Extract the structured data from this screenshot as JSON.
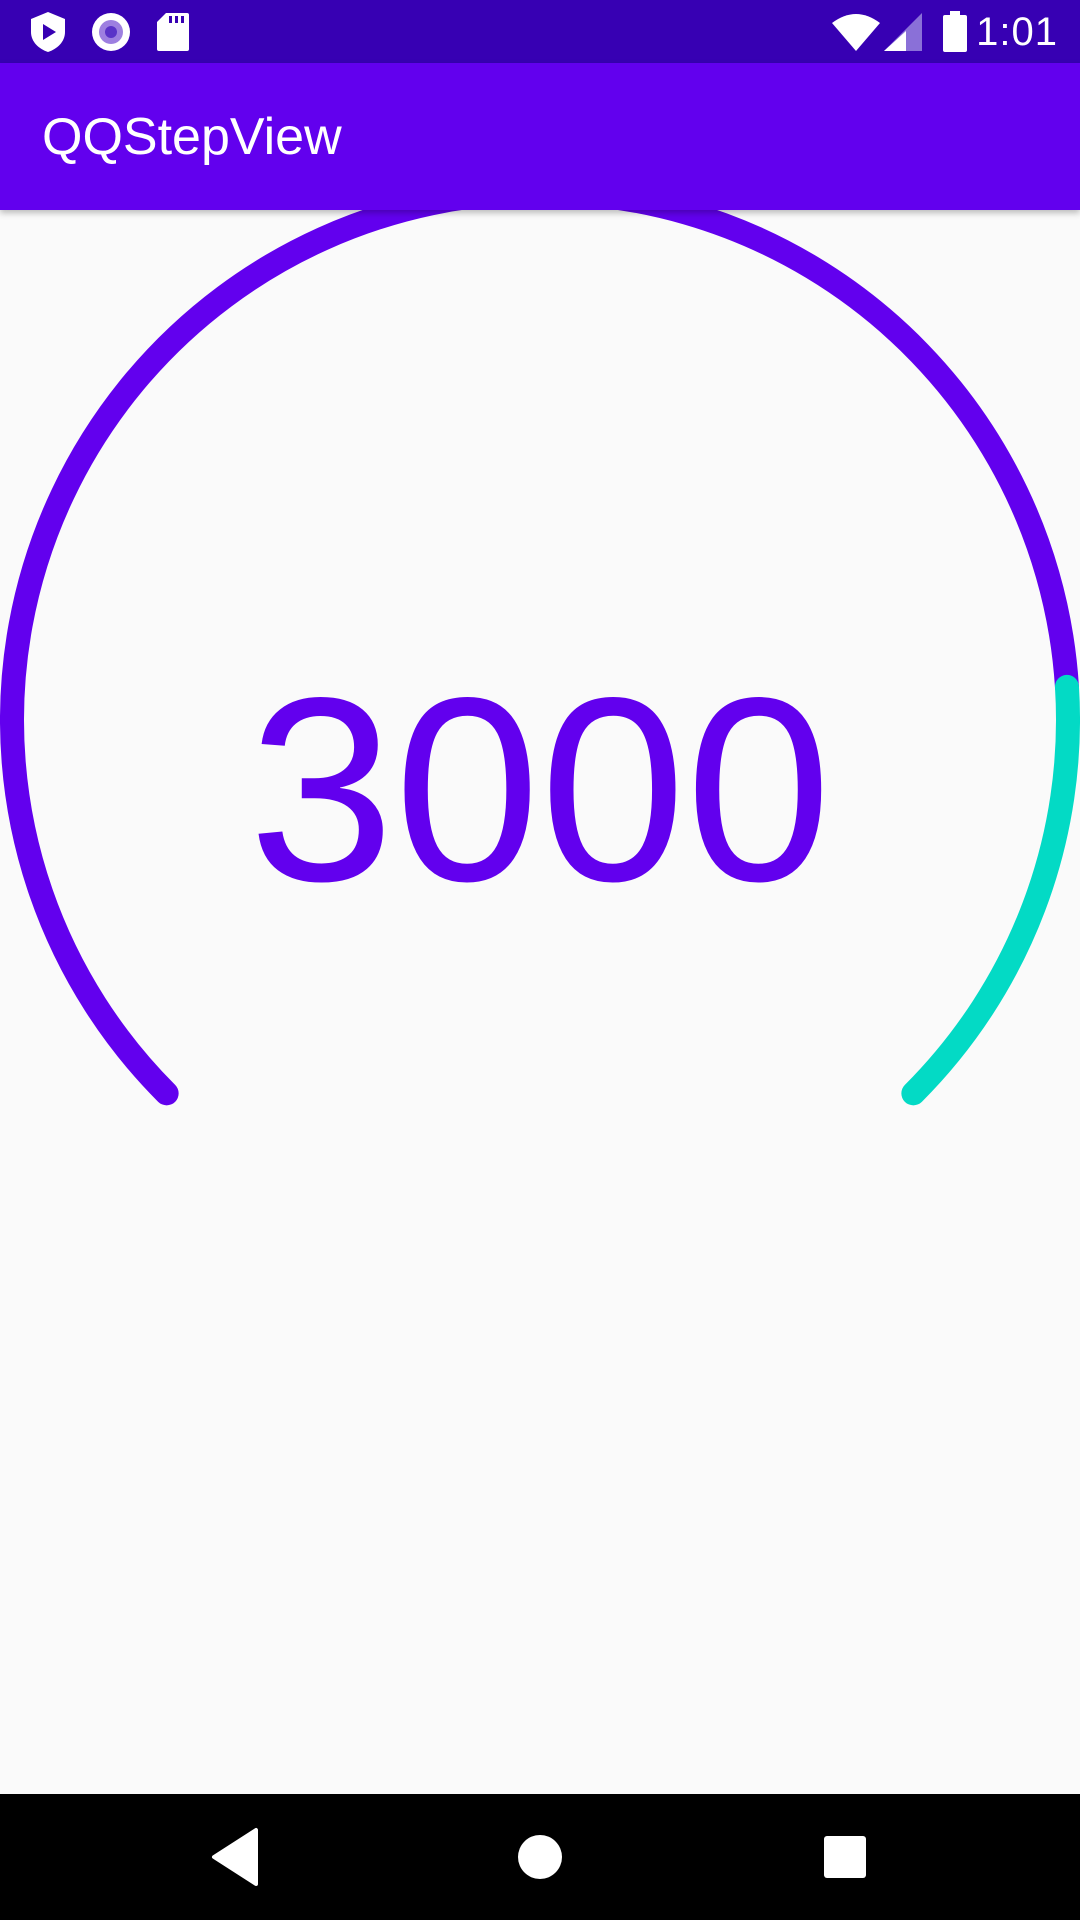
{
  "status_bar": {
    "time": "1:01",
    "left_icons": [
      "shield-play-icon",
      "record-icon",
      "sd-card-icon"
    ],
    "right_icons": [
      "wifi-icon",
      "cell-signal-icon",
      "battery-icon"
    ]
  },
  "app_bar": {
    "title": "QQStepView"
  },
  "step_view": {
    "current_step": "3000",
    "progress_fraction": 0.82,
    "outer_color": "#6200ee",
    "inner_color": "#03dac5",
    "text_color": "#6200ee"
  },
  "nav_bar": {
    "buttons": [
      "back-icon",
      "home-icon",
      "recents-icon"
    ]
  },
  "colors": {
    "status_bar": "#3700b3",
    "app_bar": "#6200ee",
    "background": "#fafafa",
    "nav_bar": "#000000"
  }
}
